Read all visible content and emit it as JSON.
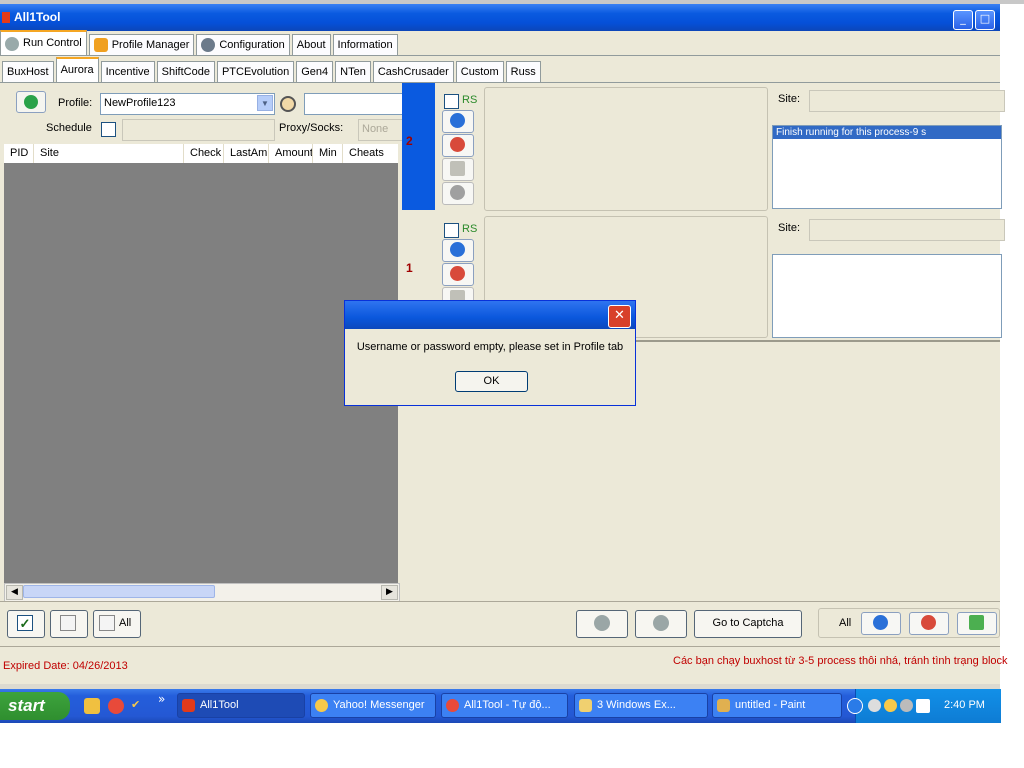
{
  "window": {
    "title": "All1Tool"
  },
  "main_tabs": [
    "Run Control",
    "Profile Manager",
    "Configuration",
    "About",
    "Information"
  ],
  "site_tabs": [
    "BuxHost",
    "Aurora",
    "Incentive",
    "ShiftCode",
    "PTCEvolution",
    "Gen4",
    "NTen",
    "CashCrusader",
    "Custom",
    "Russ"
  ],
  "selected_site_tab": "Aurora",
  "profile": {
    "label": "Profile:",
    "value": "NewProfile123",
    "schedule_label": "Schedule",
    "proxy_label": "Proxy/Socks:",
    "proxy_value": "None"
  },
  "list": {
    "columns": [
      "PID",
      "Site",
      "Check",
      "LastAm",
      "Amount",
      "Min",
      "Cheats"
    ]
  },
  "processes": [
    {
      "num": "2",
      "rs_label": "RS",
      "site_label": "Site:",
      "log": "Finish running for this process-9 s"
    },
    {
      "num": "1",
      "rs_label": "RS",
      "site_label": "Site:",
      "log": ""
    }
  ],
  "bottom": {
    "all_label": "All",
    "captcha_label": "Go to Captcha",
    "all_right_label": "All"
  },
  "status": {
    "expired": "Expired Date: 04/26/2013",
    "notice": "Các bạn chạy buxhost từ 3-5 process thôi nhá, tránh tình trạng block"
  },
  "dialog": {
    "message": "Username or password empty, please set in Profile tab",
    "ok_label": "OK"
  },
  "taskbar": {
    "start_label": "start",
    "buttons": [
      "All1Tool",
      "Yahoo! Messenger",
      "All1Tool - Tự độ...",
      "3 Windows Ex...",
      "untitled - Paint"
    ],
    "clock": "2:40 PM"
  },
  "colors": {
    "title_blue": "#0a5ae0",
    "accent_orange": "#f5a623",
    "status_red": "#c00000"
  }
}
